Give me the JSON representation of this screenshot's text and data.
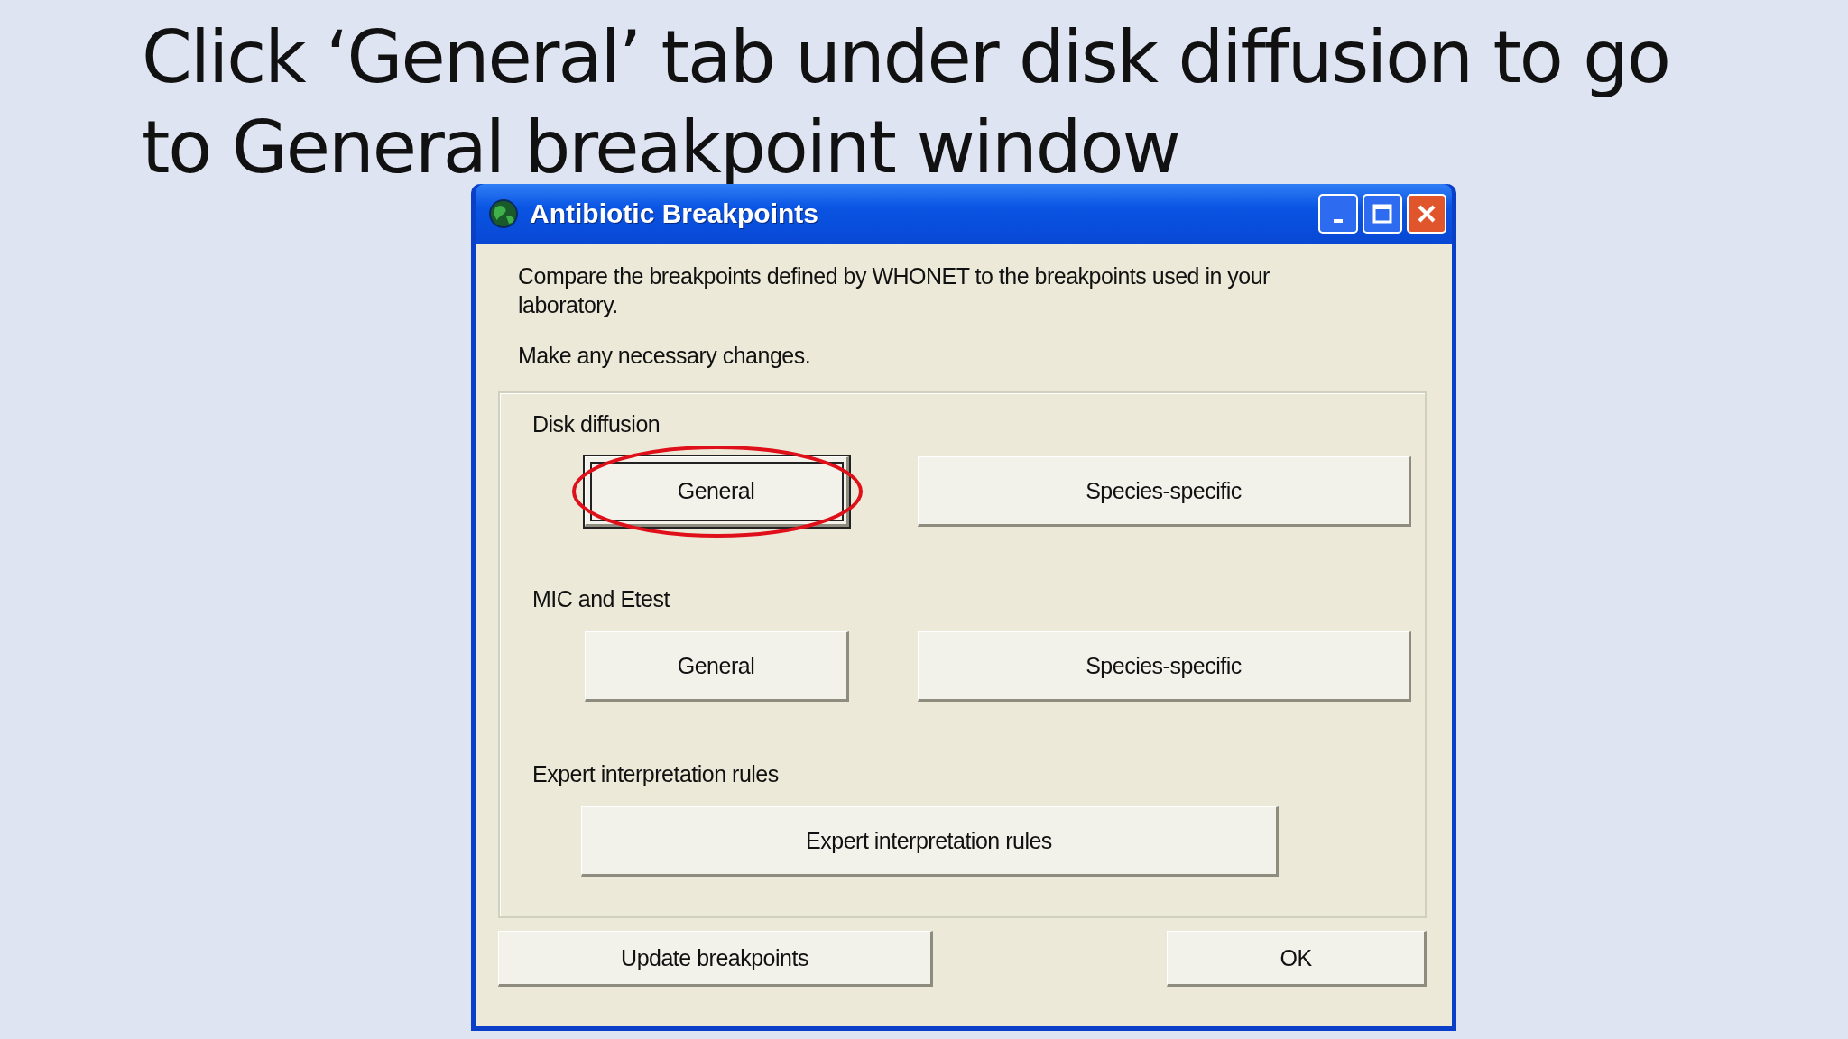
{
  "slide": {
    "title": "Click ‘General’ tab under disk diffusion to go to General breakpoint window"
  },
  "window": {
    "title": "Antibiotic Breakpoints",
    "description": "Compare the breakpoints defined by WHONET to the breakpoints used in your laboratory.",
    "instruction": "Make any necessary changes.",
    "sections": [
      {
        "label": "Disk diffusion",
        "buttons": [
          {
            "label": "General",
            "kind": "small",
            "focused": true,
            "highlighted": true
          },
          {
            "label": "Species-specific",
            "kind": "wide",
            "focused": false,
            "highlighted": false
          }
        ]
      },
      {
        "label": "MIC and Etest",
        "buttons": [
          {
            "label": "General",
            "kind": "small",
            "focused": false,
            "highlighted": false
          },
          {
            "label": "Species-specific",
            "kind": "wide",
            "focused": false,
            "highlighted": false
          }
        ]
      },
      {
        "label": "Expert interpretation rules",
        "buttons": [
          {
            "label": "Expert interpretation rules",
            "kind": "full",
            "focused": false,
            "highlighted": false
          }
        ]
      }
    ],
    "footer_buttons": [
      {
        "label": "Update breakpoints"
      },
      {
        "label": "OK"
      }
    ]
  }
}
